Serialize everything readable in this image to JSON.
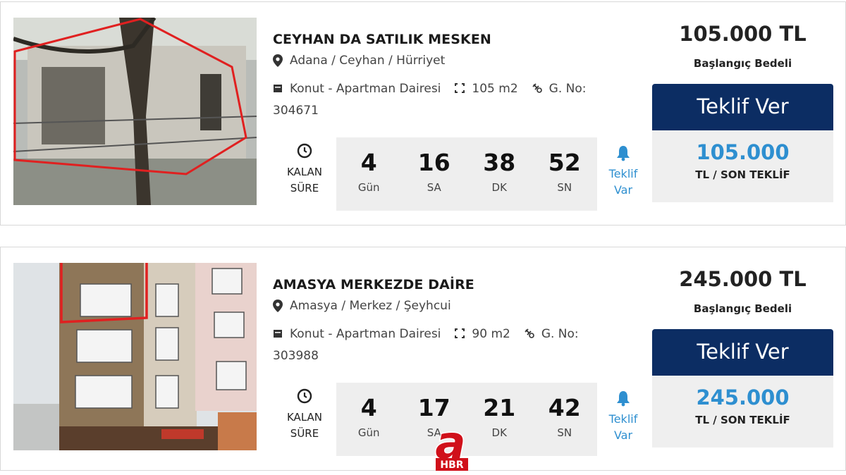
{
  "listings": [
    {
      "title": "CEYHAN DA SATILIK MESKEN",
      "location": "Adana / Ceyhan / Hürriyet",
      "type": "Konut - Apartman Dairesi",
      "area": "105 m2",
      "g_no_label": "G. No:",
      "g_no": "304671",
      "remaining_label_1": "KALAN",
      "remaining_label_2": "SÜRE",
      "timer": [
        {
          "value": "4",
          "unit": "Gün"
        },
        {
          "value": "16",
          "unit": "SA"
        },
        {
          "value": "38",
          "unit": "DK"
        },
        {
          "value": "52",
          "unit": "SN"
        }
      ],
      "offer_status_1": "Teklif",
      "offer_status_2": "Var",
      "price": "105.000 TL",
      "price_label": "Başlangıç Bedeli",
      "button_label": "Teklif Ver",
      "last_offer": "105.000",
      "last_offer_label": "TL / SON TEKLİF"
    },
    {
      "title": "AMASYA MERKEZDE DAİRE",
      "location": "Amasya / Merkez / Şeyhcui",
      "type": "Konut - Apartman Dairesi",
      "area": "90 m2",
      "g_no_label": "G. No:",
      "g_no": "303988",
      "remaining_label_1": "KALAN",
      "remaining_label_2": "SÜRE",
      "timer": [
        {
          "value": "4",
          "unit": "Gün"
        },
        {
          "value": "17",
          "unit": "SA"
        },
        {
          "value": "21",
          "unit": "DK"
        },
        {
          "value": "42",
          "unit": "SN"
        }
      ],
      "offer_status_1": "Teklif",
      "offer_status_2": "Var",
      "price": "245.000 TL",
      "price_label": "Başlangıç Bedeli",
      "button_label": "Teklif Ver",
      "last_offer": "245.000",
      "last_offer_label": "TL / SON TEKLİF"
    }
  ],
  "watermark": {
    "logo_letter": "a",
    "logo_text": "HBR"
  },
  "colors": {
    "button_bg": "#0c2d63",
    "accent_blue": "#2e8fd0",
    "timer_bg": "#eeeeee",
    "highlight_red": "#e02020",
    "logo_red": "#d0101a"
  },
  "icons": [
    "map-pin-icon",
    "building-icon",
    "area-icon",
    "auction-number-icon",
    "clock-icon",
    "bell-icon"
  ]
}
